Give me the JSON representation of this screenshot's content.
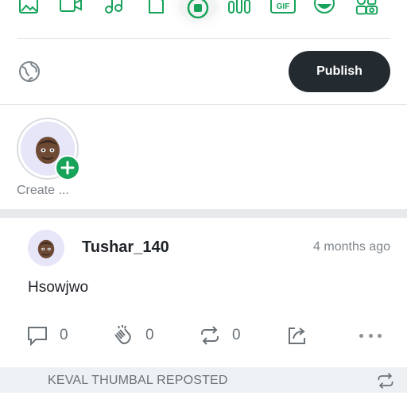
{
  "composer": {
    "toolbar": [
      {
        "name": "image-icon"
      },
      {
        "name": "video-icon"
      },
      {
        "name": "music-icon"
      },
      {
        "name": "document-icon"
      },
      {
        "name": "record-icon"
      },
      {
        "name": "poll-icon"
      },
      {
        "name": "gif-icon",
        "text": "GIF"
      },
      {
        "name": "emoji-icon"
      },
      {
        "name": "more-attachments-icon"
      }
    ],
    "accent_color": "#17a35a",
    "visibility_icon": "globe-icon",
    "publish_label": "Publish"
  },
  "stories": {
    "create_label": "Create ..."
  },
  "post": {
    "username": "Tushar_140",
    "time": "4 months ago",
    "body": "Hsowjwo",
    "actions": {
      "comments": "0",
      "claps": "0",
      "reposts": "0"
    }
  },
  "repost_strip": {
    "label": "KEVAL THUMBAL REPOSTED"
  }
}
